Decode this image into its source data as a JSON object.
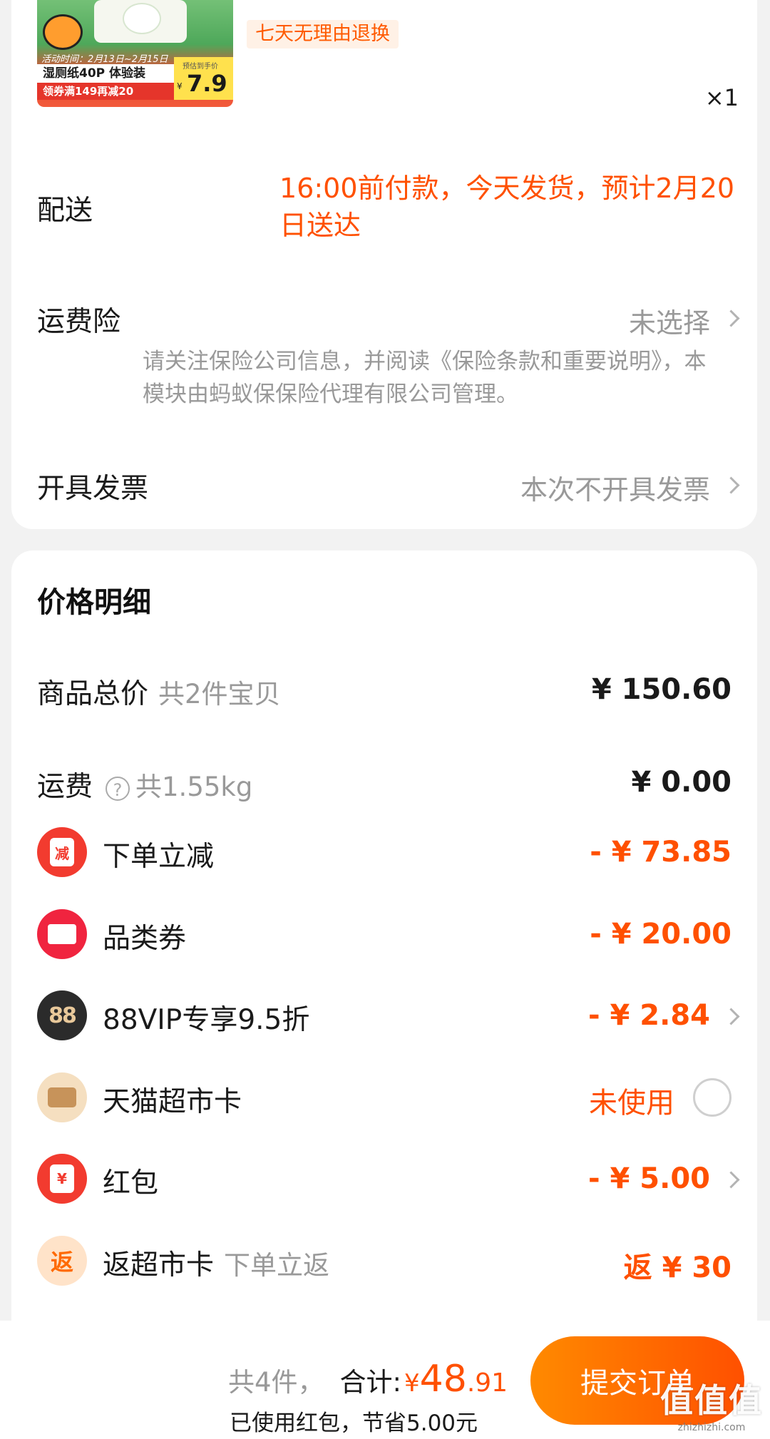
{
  "product": {
    "thumb_promo_dates": "活动时间：2月13日~2月15日",
    "thumb_title": "湿厕纸40P 体验装",
    "thumb_coupon": "领券满149再减20",
    "thumb_price_label": "预估到手价",
    "thumb_price_yen": "¥",
    "thumb_price_value": "7.9",
    "return_tag": "七天无理由退换",
    "quantity": "×1"
  },
  "delivery": {
    "label": "配送",
    "info": "16:00前付款，今天发货，预计2月20日送达"
  },
  "freight_insurance": {
    "label": "运费险",
    "value": "未选择",
    "note": "请关注保险公司信息，并阅读《保险条款和重要说明》，本模块由蚂蚁保保险代理有限公司管理。"
  },
  "invoice": {
    "label": "开具发票",
    "value": "本次不开具发票"
  },
  "price_details": {
    "title": "价格明细",
    "goods_total": {
      "label": "商品总价",
      "sub": "共2件宝贝",
      "amount": "¥ 150.60"
    },
    "shipping": {
      "label": "运费",
      "help": "?",
      "sub": "共1.55kg",
      "amount": "¥ 0.00"
    },
    "instant_discount": {
      "icon": "减",
      "label": "下单立减",
      "amount": "- ¥ 73.85"
    },
    "category_coupon": {
      "label": "品类券",
      "amount": "- ¥ 20.00"
    },
    "vip": {
      "icon": "88",
      "label": "88VIP专享9.5折",
      "amount": "- ¥ 2.84"
    },
    "market_card": {
      "label": "天猫超市卡",
      "status": "未使用"
    },
    "red_packet": {
      "icon": "¥",
      "label": "红包",
      "amount": "- ¥ 5.00"
    },
    "cashback": {
      "icon": "返",
      "label": "返超市卡",
      "sub": "下单立返",
      "amount": "返 ¥ 30"
    }
  },
  "bottom_bar": {
    "count": "共4件，",
    "total_label": "合计:",
    "total_yen": "¥",
    "total_int": "48",
    "total_dec": ".91",
    "saved_note": "已使用红包，节省5.00元",
    "submit_label": "提交订单"
  },
  "watermark": {
    "main": "值值值",
    "sub": "zhizhizhi.com"
  }
}
